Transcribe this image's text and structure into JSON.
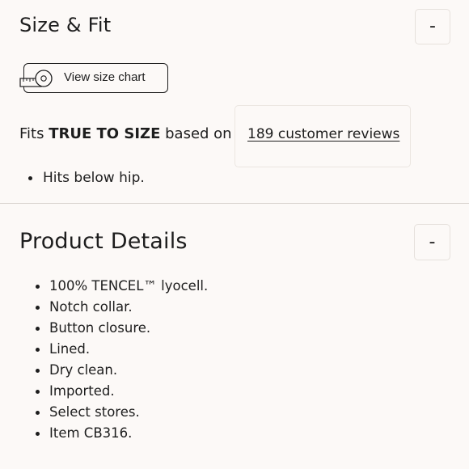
{
  "size_fit": {
    "title": "Size & Fit",
    "toggle": "-",
    "size_chart_label": "View size chart",
    "fit_prefix": "Fits ",
    "fit_bold": "TRUE TO SIZE",
    "fit_suffix": " based on",
    "reviews_link": "189 customer reviews",
    "bullets": [
      "Hits below hip."
    ]
  },
  "product_details": {
    "title": "Product Details",
    "toggle": "-",
    "bullets": [
      "100% TENCEL™ lyocell.",
      "Notch collar.",
      "Button closure.",
      "Lined.",
      "Dry clean.",
      "Imported.",
      "Select stores.",
      "Item CB316."
    ]
  },
  "colors": {
    "background": "#fcf9f7",
    "text": "#1d1d1d",
    "border": "#e6e1dc"
  },
  "icons": {
    "size_chart": "measuring-tape-icon"
  }
}
